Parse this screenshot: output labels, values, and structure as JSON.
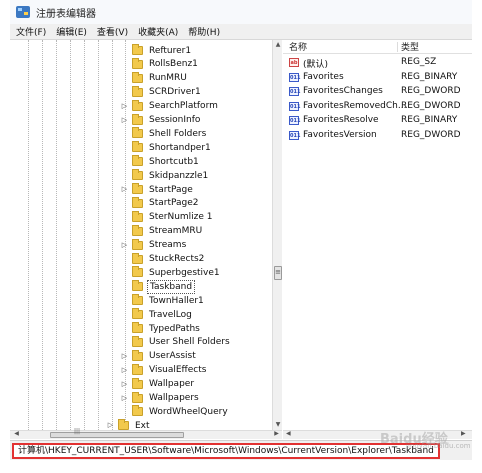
{
  "window": {
    "title": "注册表编辑器"
  },
  "menu": [
    "文件(F)",
    "编辑(E)",
    "查看(V)",
    "收藏夹(A)",
    "帮助(H)"
  ],
  "tree": {
    "items": [
      {
        "label": "Refturer1",
        "expandable": false,
        "selected": false
      },
      {
        "label": "RollsBenz1",
        "expandable": false,
        "selected": false
      },
      {
        "label": "RunMRU",
        "expandable": false,
        "selected": false
      },
      {
        "label": "SCRDriver1",
        "expandable": false,
        "selected": false
      },
      {
        "label": "SearchPlatform",
        "expandable": true,
        "selected": false
      },
      {
        "label": "SessionInfo",
        "expandable": true,
        "selected": false
      },
      {
        "label": "Shell Folders",
        "expandable": false,
        "selected": false
      },
      {
        "label": "Shortandper1",
        "expandable": false,
        "selected": false
      },
      {
        "label": "Shortcutb1",
        "expandable": false,
        "selected": false
      },
      {
        "label": "Skidpanzzle1",
        "expandable": false,
        "selected": false
      },
      {
        "label": "StartPage",
        "expandable": true,
        "selected": false
      },
      {
        "label": "StartPage2",
        "expandable": false,
        "selected": false
      },
      {
        "label": "SterNumlize 1",
        "expandable": false,
        "selected": false
      },
      {
        "label": "StreamMRU",
        "expandable": false,
        "selected": false
      },
      {
        "label": "Streams",
        "expandable": true,
        "selected": false
      },
      {
        "label": "StuckRects2",
        "expandable": false,
        "selected": false
      },
      {
        "label": "Superbgestive1",
        "expandable": false,
        "selected": false
      },
      {
        "label": "Taskband",
        "expandable": false,
        "selected": true
      },
      {
        "label": "TownHaller1",
        "expandable": false,
        "selected": false
      },
      {
        "label": "TravelLog",
        "expandable": false,
        "selected": false
      },
      {
        "label": "TypedPaths",
        "expandable": false,
        "selected": false
      },
      {
        "label": "User Shell Folders",
        "expandable": false,
        "selected": false
      },
      {
        "label": "UserAssist",
        "expandable": true,
        "selected": false
      },
      {
        "label": "VisualEffects",
        "expandable": true,
        "selected": false
      },
      {
        "label": "Wallpaper",
        "expandable": true,
        "selected": false
      },
      {
        "label": "Wallpapers",
        "expandable": true,
        "selected": false
      },
      {
        "label": "WordWheelQuery",
        "expandable": false,
        "selected": false
      },
      {
        "label": "Ext",
        "expandable": true,
        "selected": false
      }
    ]
  },
  "values": {
    "headers": {
      "name": "名称",
      "type": "类型"
    },
    "rows": [
      {
        "name": "(默认)",
        "type": "REG_SZ",
        "icon": "string-value-icon"
      },
      {
        "name": "Favorites",
        "type": "REG_BINARY",
        "icon": "binary-value-icon"
      },
      {
        "name": "FavoritesChanges",
        "type": "REG_DWORD",
        "icon": "binary-value-icon"
      },
      {
        "name": "FavoritesRemovedCh...",
        "type": "REG_DWORD",
        "icon": "binary-value-icon"
      },
      {
        "name": "FavoritesResolve",
        "type": "REG_BINARY",
        "icon": "binary-value-icon"
      },
      {
        "name": "FavoritesVersion",
        "type": "REG_DWORD",
        "icon": "binary-value-icon"
      }
    ]
  },
  "status": {
    "path": "计算机\\HKEY_CURRENT_USER\\Software\\Microsoft\\Windows\\CurrentVersion\\Explorer\\Taskband",
    "highlight_color": "#e23232"
  },
  "watermark": {
    "text": "Baidu经验",
    "sub": "jingyan.baidu.com"
  }
}
